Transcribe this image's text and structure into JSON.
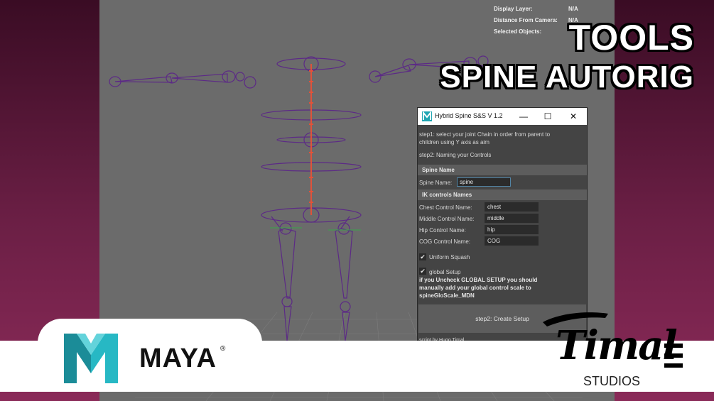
{
  "overlay": {
    "title_line1": "TOOLS",
    "title_line2": "SPINE AUTORIG"
  },
  "viewport_hud": {
    "display_layer_label": "Display Layer:",
    "display_layer_value": "N/A",
    "distance_label": "Distance From Camera:",
    "distance_value": "N/A",
    "selected_label": "Selected Objects:"
  },
  "dialog": {
    "title": "Hybrid Spine S&S V 1.2",
    "minimize_symbol": "—",
    "maximize_symbol": "☐",
    "close_symbol": "✕",
    "step1_text_line1": "step1: select your joint Chain in order from parent to",
    "step1_text_line2": "children using Y axis as aim",
    "step2_naming": "step2: Naming your Controls",
    "spine_section": "Spine Name",
    "spine_name_label": "Spine Name:",
    "spine_name_value": "spine",
    "ik_section": "IK controls Names",
    "chest_label": "Chest Control Name:",
    "chest_value": "chest",
    "middle_label": "Middle Control Name:",
    "middle_value": "middle",
    "hip_label": "Hip Control Name:",
    "hip_value": "hip",
    "cog_label": "COG Control Name:",
    "cog_value": "COG",
    "uniform_squash_label": "Uniform Squash",
    "uniform_squash_checked": true,
    "global_setup_label": "global Setup",
    "global_setup_checked": true,
    "note_line1": "if you Uncheck GLOBAL SETUP you should",
    "note_line2": "manually add your global control scale to",
    "note_line3": "spineGloScale_MDN",
    "create_button": "step2: Create Setup",
    "credit_partial": "script by Hugo Timal"
  },
  "branding": {
    "maya_letter": "M",
    "maya_word": "MAYA",
    "maya_reg": "®",
    "timal_word": "Timal",
    "studios_word": "STUDIOS"
  },
  "colors": {
    "background_purple": "#5a1a38",
    "viewport_gray": "#6b6b6b",
    "dialog_bg": "#444444",
    "section_bg": "#5d5d5d",
    "field_bg": "#2b2b2b",
    "field_focus": "#5285a6",
    "joint_purple": "#5c2a86",
    "spine_red": "#e0523a",
    "maya_teal": "#1fa6b3"
  }
}
